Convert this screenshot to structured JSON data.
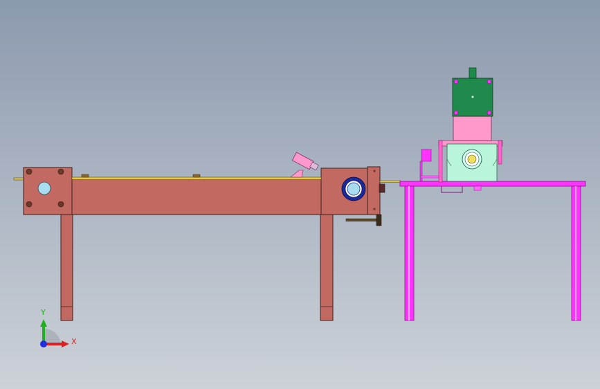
{
  "viewport": {
    "background_top": "#8c9aae",
    "background_bottom": "#cdd2d8"
  },
  "colors": {
    "bench_fill": "#c26a62",
    "bench_stroke": "#3a1f1c",
    "rail": "#e6c84a",
    "stand_fill": "#ff33ff",
    "stand_stroke": "#7a1a7a",
    "motor_green": "#1f8a4c",
    "motor_pink": "#ff99cc",
    "gearbox_mint": "#b8f5da",
    "bearing_blue": "#1a2a9a",
    "bolt_brown": "#6b3a2a"
  },
  "triad": {
    "x_label": "X",
    "y_label": "Y",
    "x_color": "#e02020",
    "y_color": "#20b020",
    "z_color": "#2030e0"
  }
}
